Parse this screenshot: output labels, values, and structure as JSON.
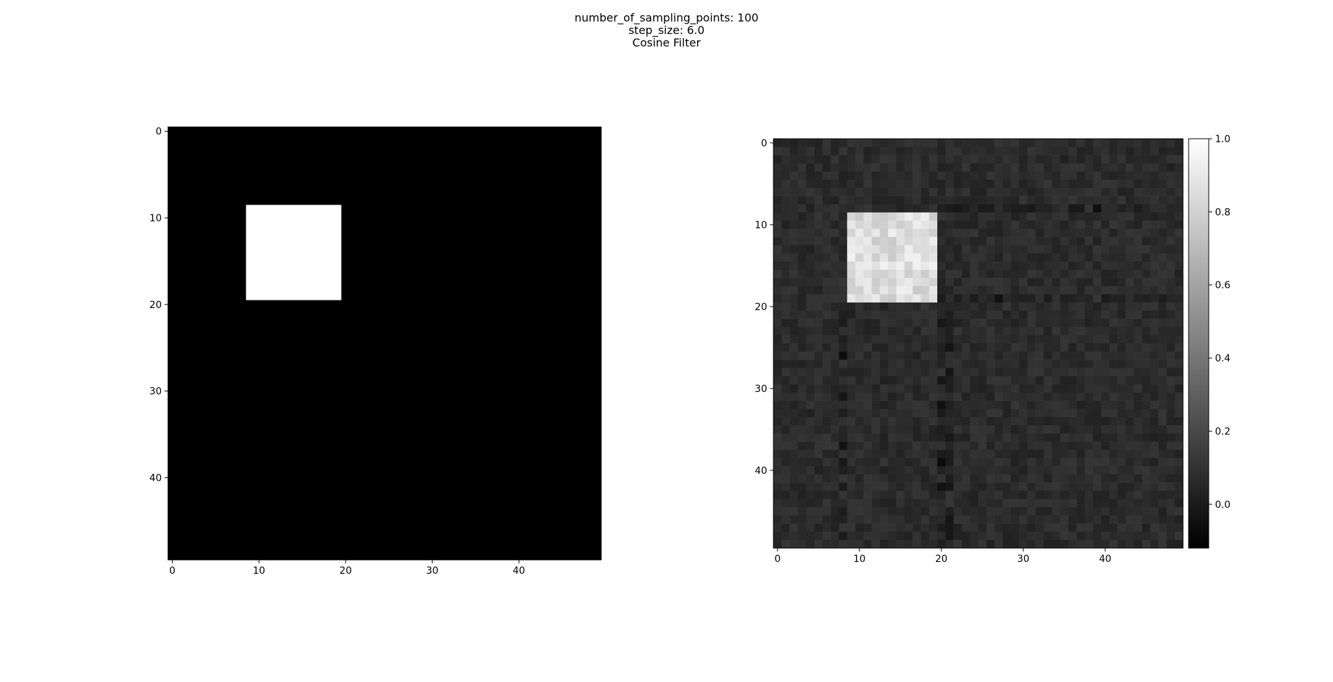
{
  "figure": {
    "title_lines": [
      "number_of_sampling_points: 100",
      "step_size: 6.0",
      "Cosine Filter"
    ]
  },
  "chart_data": [
    {
      "type": "heatmap",
      "title": "",
      "xlabel": "",
      "ylabel": "",
      "grid_size": [
        50,
        50
      ],
      "xlim": [
        -0.5,
        49.5
      ],
      "ylim": [
        49.5,
        -0.5
      ],
      "x_ticks": [
        0,
        10,
        20,
        30,
        40
      ],
      "y_ticks": [
        0,
        10,
        20,
        30,
        40
      ],
      "colormap": "gray",
      "background_value": 0.0,
      "square": {
        "rows": [
          9,
          19
        ],
        "cols": [
          9,
          19
        ],
        "value": 1.0
      },
      "grid": false
    },
    {
      "type": "heatmap",
      "title": "",
      "xlabel": "",
      "ylabel": "",
      "grid_size": [
        50,
        50
      ],
      "xlim": [
        -0.5,
        49.5
      ],
      "ylim": [
        49.5,
        -0.5
      ],
      "x_ticks": [
        0,
        10,
        20,
        30,
        40
      ],
      "y_ticks": [
        0,
        10,
        20,
        30,
        40
      ],
      "colormap": "gray",
      "vmin": -0.12,
      "vmax": 1.0,
      "background_value": 0.07,
      "square": {
        "rows": [
          9,
          19
        ],
        "cols": [
          9,
          19
        ],
        "value": 0.85
      },
      "streaks": {
        "rows": [
          8,
          19
        ],
        "cols": [
          8,
          20,
          21
        ],
        "value": -0.02
      },
      "grid": false,
      "colorbar": {
        "ticks": [
          1.0,
          0.8,
          0.6,
          0.4,
          0.2,
          0.0
        ],
        "labels": [
          "1.0",
          "0.8",
          "0.6",
          "0.4",
          "0.2",
          "0.0"
        ],
        "position": "right"
      }
    }
  ]
}
